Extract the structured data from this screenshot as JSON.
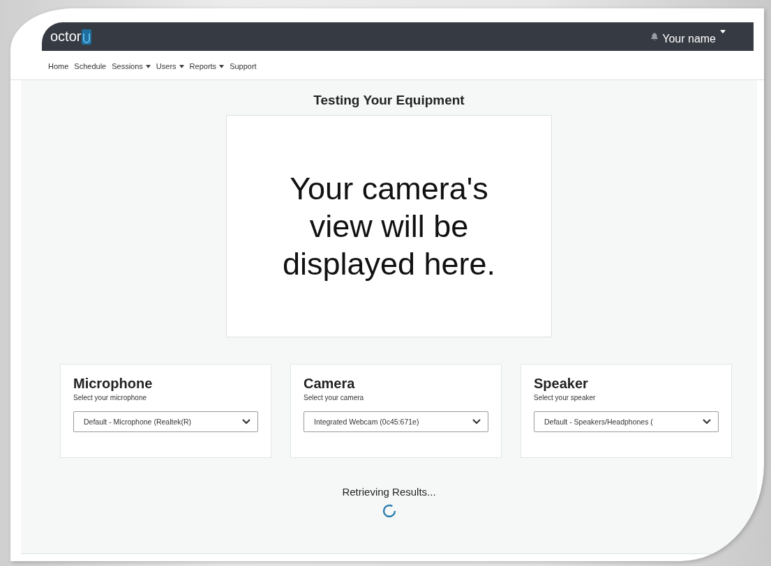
{
  "header": {
    "logo": "octor",
    "user": "Your name"
  },
  "nav": [
    {
      "label": "Home",
      "dropdown": false
    },
    {
      "label": "Schedule",
      "dropdown": false
    },
    {
      "label": "Sessions",
      "dropdown": true
    },
    {
      "label": "Users",
      "dropdown": true
    },
    {
      "label": "Reports",
      "dropdown": true
    },
    {
      "label": "Support",
      "dropdown": false
    }
  ],
  "title": "Testing Your Equipment",
  "camera_placeholder": "Your camera's view will be displayed here.",
  "devices": [
    {
      "title": "Microphone",
      "hint": "Select your microphone",
      "value": "Default - Microphone (Realtek(R)"
    },
    {
      "title": "Camera",
      "hint": "Select your camera",
      "value": "Integrated Webcam (0c45:671e)"
    },
    {
      "title": "Speaker",
      "hint": "Select your speaker",
      "value": "Default - Speakers/Headphones ("
    }
  ],
  "status": "Retrieving Results..."
}
